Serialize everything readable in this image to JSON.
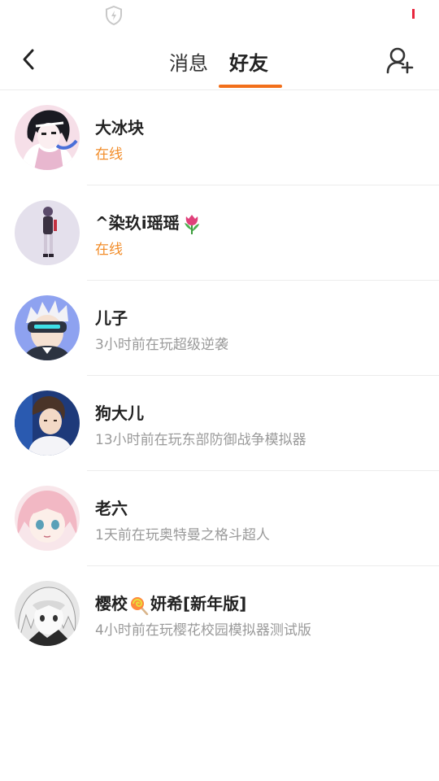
{
  "header": {
    "tabs": [
      {
        "label": "消息",
        "active": false
      },
      {
        "label": "好友",
        "active": true
      }
    ],
    "accent_color": "#f26f1a"
  },
  "friends": [
    {
      "name": "大冰块",
      "status": "在线",
      "online": true
    },
    {
      "name_prefix": "^染玖i瑶瑶",
      "name_emoji": "tulip-emoji",
      "name": "^染玖i瑶瑶",
      "status": "在线",
      "online": true
    },
    {
      "name": "儿子",
      "status": "3小时前在玩超级逆袭",
      "online": false
    },
    {
      "name": "狗大儿",
      "status": "13小时前在玩东部防御战争模拟器",
      "online": false
    },
    {
      "name": "老六",
      "status": "1天前在玩奥特曼之格斗超人",
      "online": false
    },
    {
      "name_prefix": "樱校",
      "name_emoji": "lollipop-emoji",
      "name_suffix": "妍希[新年版]",
      "status": "4小时前在玩樱花校园模拟器测试版",
      "online": false
    }
  ]
}
